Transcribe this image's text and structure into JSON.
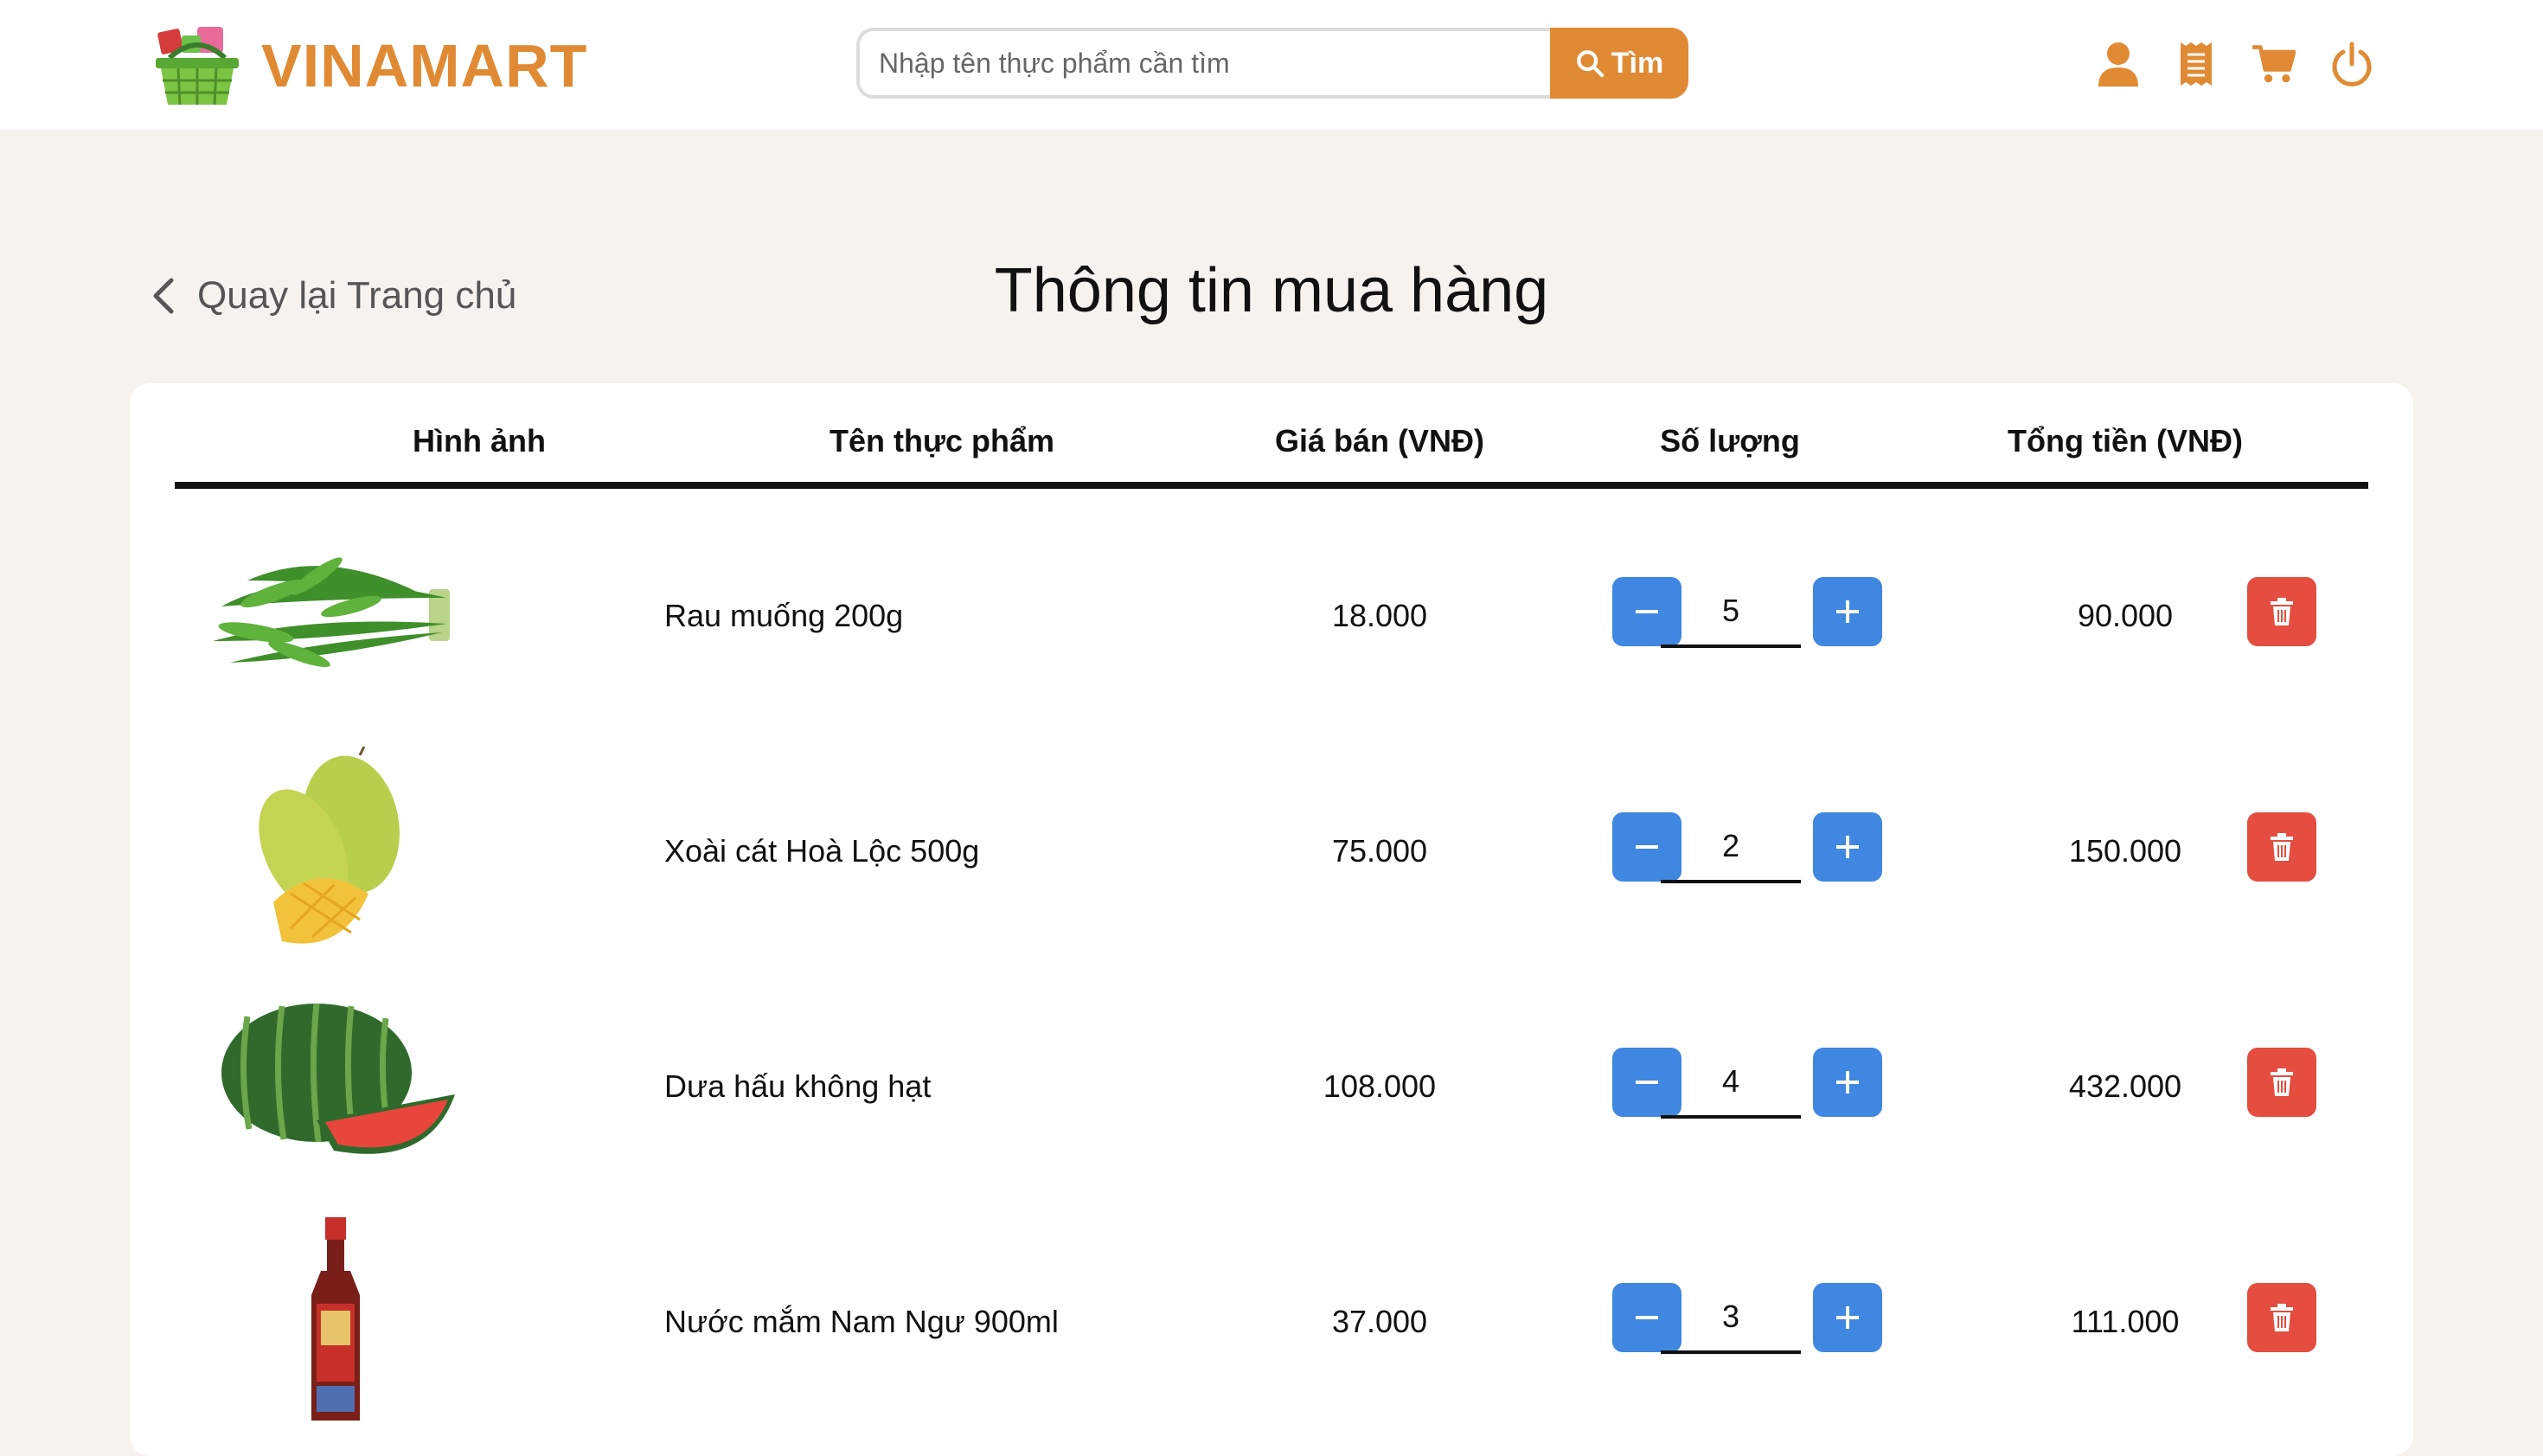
{
  "brand": {
    "name": "VINAMART",
    "color": "#e08a34"
  },
  "search": {
    "placeholder": "Nhập tên thực phẩm cần tìm",
    "button_label": "Tìm"
  },
  "header_icons": [
    "user-icon",
    "receipt-icon",
    "cart-icon",
    "power-icon"
  ],
  "back_link": "Quay lại Trang chủ",
  "page_title": "Thông tin mua hàng",
  "table": {
    "headers": [
      "Hình ảnh",
      "Tên thực phẩm",
      "Giá bán (VNĐ)",
      "Số lượng",
      "Tổng tiền (VNĐ)"
    ],
    "rows": [
      {
        "name": "Rau muống 200g",
        "price": "18.000",
        "qty": "5",
        "total": "90.000",
        "image": "water-spinach"
      },
      {
        "name": "Xoài cát Hoà Lộc 500g",
        "price": "75.000",
        "qty": "2",
        "total": "150.000",
        "image": "mango"
      },
      {
        "name": "Dưa hấu không hạt",
        "price": "108.000",
        "qty": "4",
        "total": "432.000",
        "image": "watermelon"
      },
      {
        "name": "Nước mắm Nam Ngư 900ml",
        "price": "37.000",
        "qty": "3",
        "total": "111.000",
        "image": "fish-sauce-bottle"
      }
    ]
  },
  "colors": {
    "accent": "#e08a34",
    "qty_button": "#3f87e0",
    "delete_button": "#e44d3f",
    "background": "#f6f3ef"
  }
}
